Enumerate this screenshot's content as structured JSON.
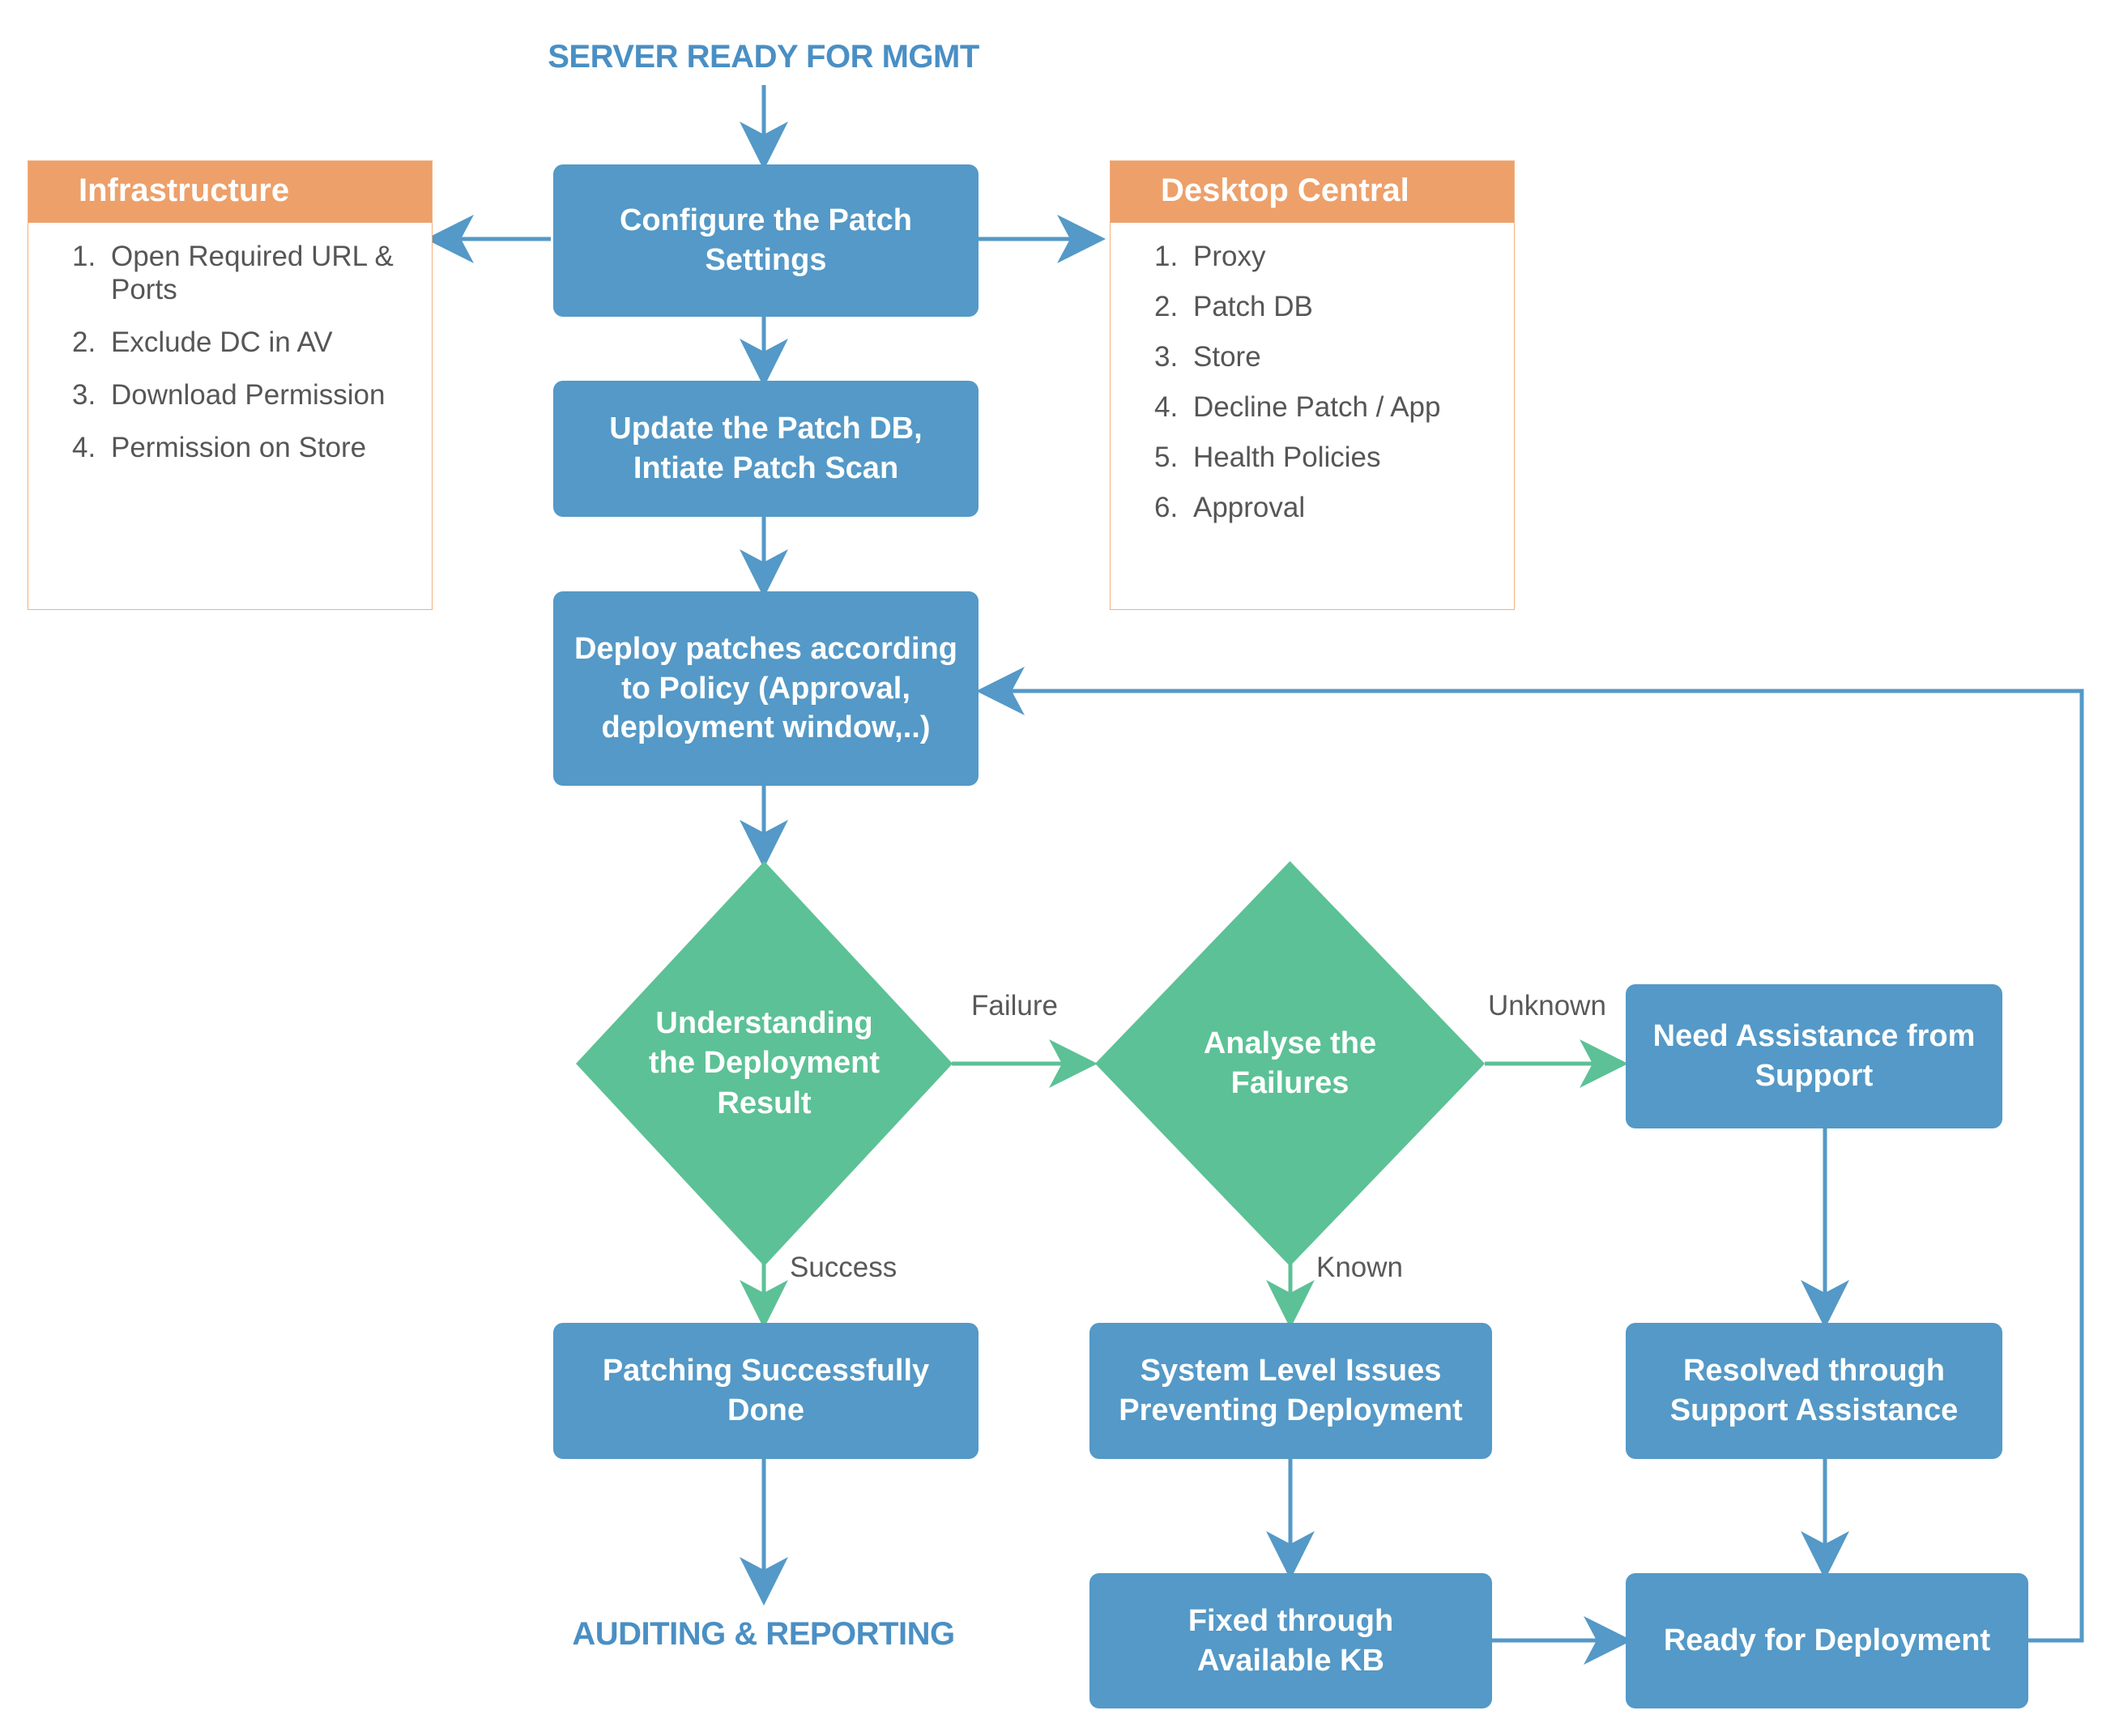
{
  "colors": {
    "process_blue": "#5499c7",
    "decision_green": "#5cc196",
    "panel_header_orange": "#eda06a",
    "terminator_text_blue": "#4a8fc4",
    "edge_blue": "#5499c7",
    "edge_green": "#5cc196",
    "body_text_gray": "#565656"
  },
  "terminators": {
    "start": "SERVER READY FOR MGMT",
    "end": "AUDITING & REPORTING"
  },
  "panels": {
    "infrastructure": {
      "title": "Infrastructure",
      "items": [
        {
          "num": "1.",
          "text": "Open Required URL & Ports"
        },
        {
          "num": "2.",
          "text": "Exclude DC in AV"
        },
        {
          "num": "3.",
          "text": "Download Permission"
        },
        {
          "num": "4.",
          "text": "Permission on Store"
        }
      ]
    },
    "desktop_central": {
      "title": "Desktop Central",
      "items": [
        {
          "num": "1.",
          "text": "Proxy"
        },
        {
          "num": "2.",
          "text": "Patch DB"
        },
        {
          "num": "3.",
          "text": "Store"
        },
        {
          "num": "4.",
          "text": "Decline Patch / App"
        },
        {
          "num": "5.",
          "text": "Health Policies"
        },
        {
          "num": "6.",
          "text": "Approval"
        }
      ]
    }
  },
  "nodes": {
    "configure_patch_settings": {
      "line1": "Configure the Patch",
      "line2": "Settings"
    },
    "update_patch_db": {
      "line1": "Update the Patch DB,",
      "line2": "Intiate Patch Scan"
    },
    "deploy_patches": {
      "line1": "Deploy patches according",
      "line2": "to Policy (Approval,",
      "line3": "deployment window,..)"
    },
    "understanding_result": {
      "line1": "Understanding",
      "line2": "the Deployment",
      "line3": "Result"
    },
    "analyse_failures": {
      "line1": "Analyse the",
      "line2": "Failures"
    },
    "need_assistance": {
      "line1": "Need Assistance from",
      "line2": "Support"
    },
    "patching_done": {
      "line1": "Patching Successfully",
      "line2": "Done"
    },
    "system_level_issues": {
      "line1": "System Level Issues",
      "line2": "Preventing Deployment"
    },
    "resolved_support": {
      "line1": "Resolved through",
      "line2": "Support Assistance"
    },
    "fixed_kb": {
      "line1": "Fixed through",
      "line2": "Available KB"
    },
    "ready_for_deployment": {
      "line1": "Ready for Deployment"
    }
  },
  "edge_labels": {
    "failure": "Failure",
    "unknown": "Unknown",
    "success": "Success",
    "known": "Known"
  }
}
